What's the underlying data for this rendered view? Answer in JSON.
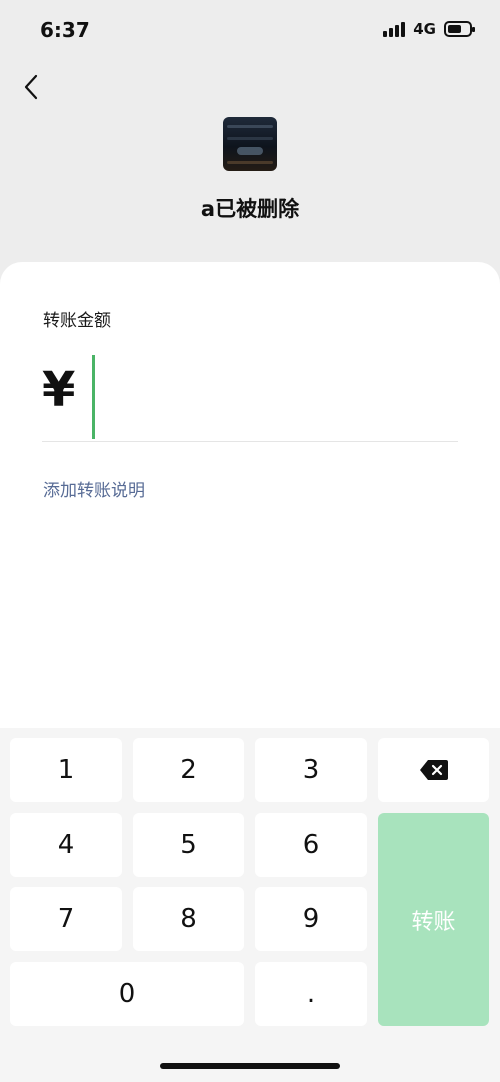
{
  "status_bar": {
    "time": "6:37",
    "network": "4G",
    "battery_level": 0.65
  },
  "header": {
    "back_icon": "chevron-left-icon",
    "recipient_name": "a已被删除"
  },
  "transfer": {
    "amount_label": "转账金额",
    "currency_symbol": "¥",
    "amount_value": "",
    "remark_link": "添加转账说明"
  },
  "keypad": {
    "keys": {
      "one": "1",
      "two": "2",
      "three": "3",
      "four": "4",
      "five": "5",
      "six": "6",
      "seven": "7",
      "eight": "8",
      "nine": "9",
      "zero": "0",
      "dot": "."
    },
    "delete_icon": "backspace-icon",
    "submit_label": "转账"
  },
  "colors": {
    "page_bg": "#ededed",
    "cursor": "#4ab466",
    "link": "#576b95",
    "submit_disabled": "#a8e3bd"
  }
}
